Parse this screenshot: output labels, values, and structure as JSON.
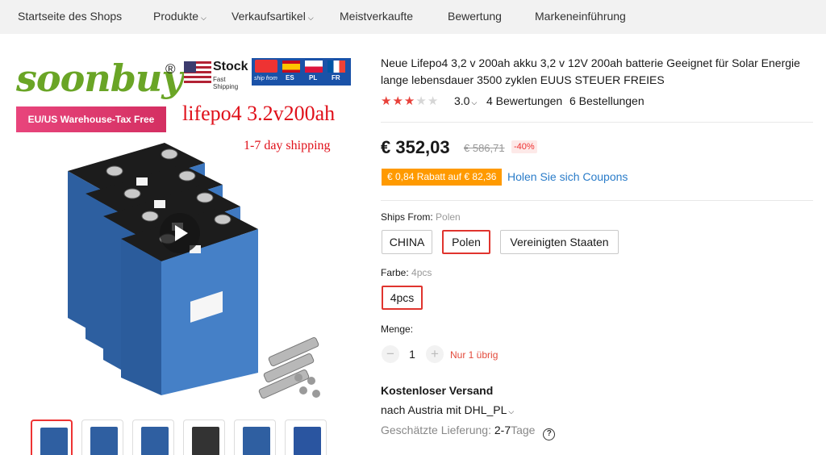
{
  "nav": {
    "items": [
      {
        "label": "Startseite des Shops",
        "dropdown": false
      },
      {
        "label": "Produkte",
        "dropdown": true
      },
      {
        "label": "Verkaufsartikel",
        "dropdown": true
      },
      {
        "label": "Meistverkaufte",
        "dropdown": false
      },
      {
        "label": "Bewertung",
        "dropdown": false
      },
      {
        "label": "Markeneinführung",
        "dropdown": false
      }
    ]
  },
  "gallery": {
    "logo_text": "soonbuy",
    "logo_registered": "®",
    "stock_word": "Stock",
    "fast_shipping": "Fast Shipping",
    "ship_from": "ship from",
    "flags": [
      "ES",
      "PL",
      "FR"
    ],
    "eu_banner": "EU/US Warehouse-Tax Free",
    "promo_title": "lifepo4 3.2v200ah",
    "promo_shipping": "1-7 day shipping",
    "play_icon": "play-icon",
    "thumbnail_count": 6,
    "active_thumbnail": 0
  },
  "product": {
    "title": "Neue Lifepo4 3,2 v 200ah akku 3,2 v 12V 200ah batterie Geeignet für Solar Energie lange lebensdauer 3500 zyklen EUUS STEUER FREIES",
    "rating_stars": 3,
    "rating_max": 5,
    "rating_value": "3.0",
    "reviews": "4 Bewertungen",
    "orders": "6 Bestellungen"
  },
  "price": {
    "current": "€ 352,03",
    "original": "€ 586,71",
    "discount": "-40%",
    "coupon_tag": "€ 0,84 Rabatt auf € 82,36",
    "coupon_link": "Holen Sie sich Coupons"
  },
  "options": {
    "ships_from": {
      "label": "Ships From:",
      "selected": "Polen",
      "choices": [
        "CHINA",
        "Polen",
        "Vereinigten Staaten"
      ],
      "active_index": 1
    },
    "color": {
      "label": "Farbe:",
      "selected": "4pcs",
      "choices": [
        "4pcs"
      ],
      "active_index": 0
    }
  },
  "quantity": {
    "label": "Menge:",
    "minus": "−",
    "plus": "+",
    "value": "1",
    "stock_note": "Nur 1 übrig"
  },
  "shipping": {
    "title": "Kostenloser Versand",
    "destination": "nach Austria mit DHL_PL",
    "delivery_label": "Geschätzte Lieferung:",
    "delivery_days": "2-7",
    "delivery_unit": "Tage",
    "help_icon": "?"
  },
  "colors": {
    "accent_red": "#e0342e",
    "link_blue": "#2a7cc9",
    "coupon_orange": "#ff9a00",
    "star_red": "#e8413a"
  }
}
